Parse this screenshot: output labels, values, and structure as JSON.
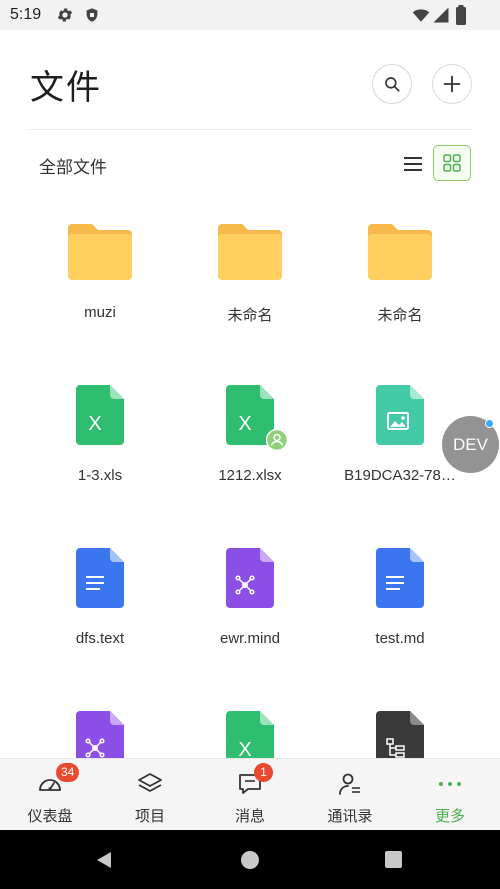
{
  "status_bar": {
    "time": "5:19",
    "icons": [
      "gear-icon",
      "shield-icon",
      "wifi-icon",
      "signal-icon",
      "battery-icon"
    ]
  },
  "header": {
    "title": "文件",
    "search_icon": "search-icon",
    "add_icon": "plus-icon"
  },
  "breadcrumb": {
    "label": "全部文件"
  },
  "view_toggle": {
    "list_icon": "list-view-icon",
    "grid_icon": "grid-view-icon",
    "active": "grid"
  },
  "files": [
    {
      "name": "muzi",
      "type": "folder"
    },
    {
      "name": "未命名",
      "type": "folder"
    },
    {
      "name": "未命名",
      "type": "folder"
    },
    {
      "name": "1-3.xls",
      "type": "excel"
    },
    {
      "name": "1212.xlsx",
      "type": "excel-shared"
    },
    {
      "name": "B19DCA32-78…",
      "type": "image"
    },
    {
      "name": "dfs.text",
      "type": "doc"
    },
    {
      "name": "ewr.mind",
      "type": "mind"
    },
    {
      "name": "test.md",
      "type": "doc"
    },
    {
      "name": "",
      "type": "mind"
    },
    {
      "name": "",
      "type": "excel"
    },
    {
      "name": "",
      "type": "flow"
    }
  ],
  "dev_bubble": {
    "label": "DEV"
  },
  "bottom_nav": {
    "items": [
      {
        "label": "仪表盘",
        "icon": "dashboard-icon",
        "badge": "34"
      },
      {
        "label": "项目",
        "icon": "layers-icon",
        "badge": ""
      },
      {
        "label": "消息",
        "icon": "message-icon",
        "badge": "1"
      },
      {
        "label": "通讯录",
        "icon": "contacts-icon",
        "badge": ""
      },
      {
        "label": "更多",
        "icon": "more-dots-icon",
        "badge": "",
        "active": true
      }
    ]
  },
  "colors": {
    "accent": "#4caf50",
    "folder": "#ffc94d",
    "excel": "#2fbd6f",
    "doc": "#3b76f0",
    "mind": "#8b4fe6",
    "image": "#43c9a6",
    "flow": "#3a3a3a",
    "badge": "#e8492f"
  }
}
